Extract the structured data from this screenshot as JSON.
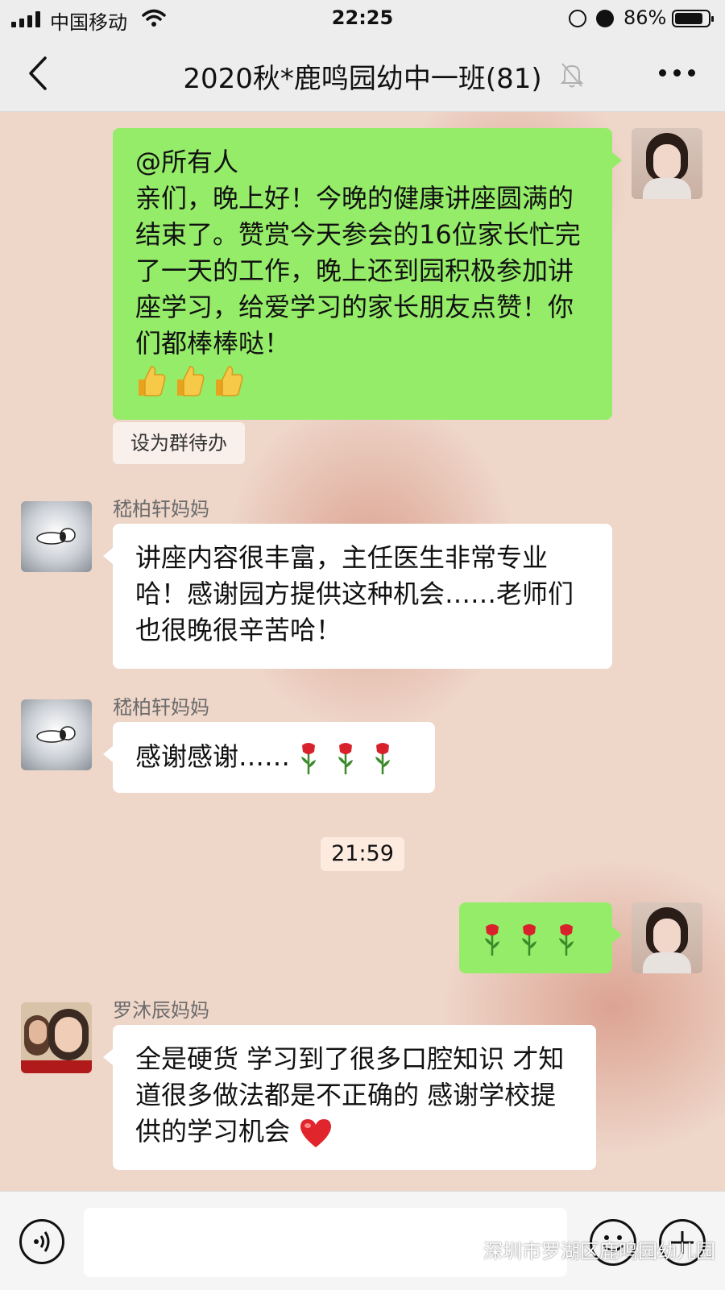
{
  "status_bar": {
    "carrier": "中国移动",
    "time": "22:25",
    "battery_percent": "86%",
    "battery_level": 0.86,
    "icons": [
      "signal-icon",
      "wifi-icon",
      "rotation-lock-icon",
      "alarm-icon",
      "battery-icon"
    ]
  },
  "header": {
    "title": "2020秋*鹿鸣园幼中一班(81)",
    "icons": [
      "back-icon",
      "mute-bell-icon",
      "more-icon"
    ]
  },
  "messages": [
    {
      "direction": "out",
      "text": "@所有人\n亲们，晚上好！今晚的健康讲座圆满的结束了。赞赏今天参会的16位家长忙完了一天的工作，晚上还到园积极参加讲座学习，给爱学习的家长朋友点赞！你们都棒棒哒！",
      "emoji": [
        "thumbs-up",
        "thumbs-up",
        "thumbs-up"
      ]
    },
    {
      "type": "todo-chip",
      "text": "设为群待办"
    },
    {
      "direction": "in",
      "sender": "嵇柏轩妈妈",
      "text": "讲座内容很丰富，主任医生非常专业哈！感谢园方提供这种机会……老师们也很晚很辛苦哈！"
    },
    {
      "direction": "in",
      "sender": "嵇柏轩妈妈",
      "text": "感谢感谢……",
      "emoji": [
        "rose",
        "rose",
        "rose"
      ]
    },
    {
      "type": "timestamp",
      "text": "21:59"
    },
    {
      "direction": "out",
      "text": "",
      "emoji": [
        "rose",
        "rose",
        "rose"
      ]
    },
    {
      "direction": "in",
      "sender": "罗沐辰妈妈",
      "text": "全是硬货 学习到了很多口腔知识 才知道很多做法都是不正确的 感谢学校提供的学习机会",
      "emoji": [
        "red-heart"
      ]
    }
  ],
  "input_bar": {
    "icons": [
      "voice-icon",
      "emoji-icon",
      "plus-icon"
    ],
    "input_value": ""
  },
  "watermark": {
    "text": "深圳市罗湖区鹿鸣园幼儿园"
  },
  "colors": {
    "outgoing_bubble": "#95ec69",
    "incoming_bubble": "#ffffff",
    "bar_background": "#ededed"
  }
}
